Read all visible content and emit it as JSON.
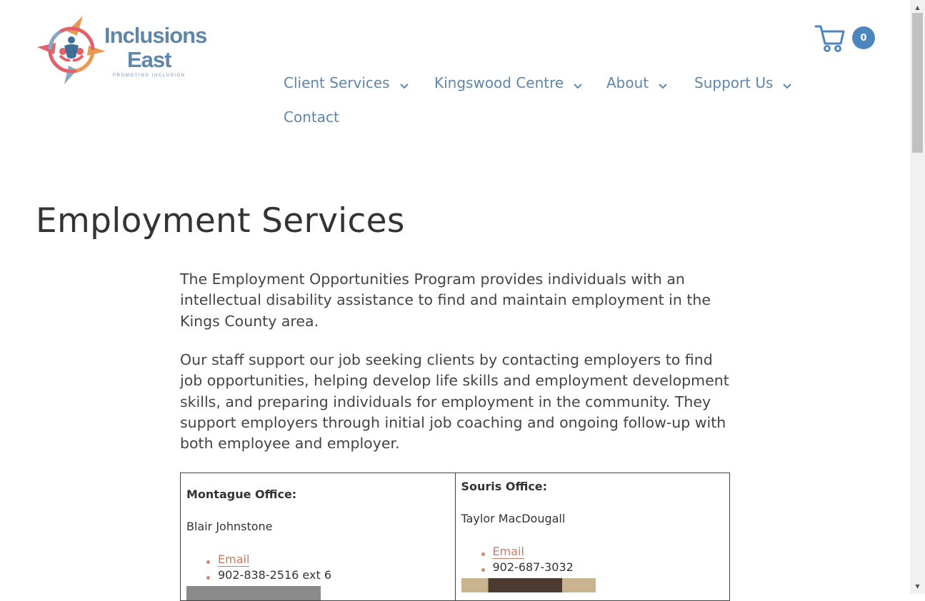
{
  "brand": {
    "line1": "Inclusions",
    "line2": "East",
    "tagline": "PROMOTING INCLUSION",
    "color": "#5f86a9"
  },
  "cart": {
    "count": "0",
    "icon": "cart-icon",
    "badge_color": "#4d86bf"
  },
  "nav": {
    "items": [
      {
        "label": "Client Services",
        "has_dropdown": true
      },
      {
        "label": "Kingswood Centre",
        "has_dropdown": true
      },
      {
        "label": "About",
        "has_dropdown": true
      },
      {
        "label": "Support Us",
        "has_dropdown": true
      },
      {
        "label": "Contact",
        "has_dropdown": false
      }
    ]
  },
  "page": {
    "title": "Employment Services",
    "paragraph1": "The Employment Opportunities Program provides individuals with an intellectual disability assistance to find and maintain employment in the Kings County area.",
    "paragraph2": "Our staff support our job seeking clients by contacting employers to find job opportunities, helping develop life skills and employment development skills, and preparing individuals for employment in the community. They support employers through initial job coaching and ongoing follow-up with both employee and employer."
  },
  "offices": [
    {
      "label": "Montague Office:",
      "staff": "Blair Johnstone",
      "email_label": "Email",
      "phone": "902-838-2516 ext 6"
    },
    {
      "label": "Souris Office:",
      "staff": "Taylor MacDougall",
      "email_label": "Email",
      "phone": "902-687-3032"
    }
  ],
  "colors": {
    "link": "#c97a66",
    "bullet": "#d08870",
    "heading": "#333333"
  }
}
